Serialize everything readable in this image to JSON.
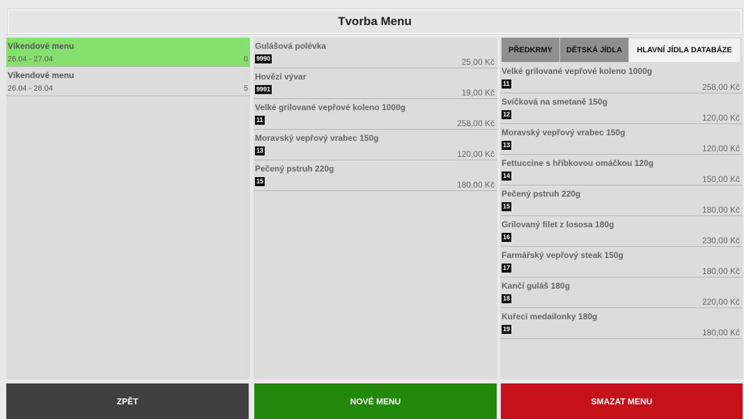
{
  "header": {
    "title": "Tvorba Menu"
  },
  "menus": [
    {
      "name": "Víkendové menu",
      "dates": "26.04 - 27.04",
      "count": "0",
      "selected": true
    },
    {
      "name": "Víkendové menu",
      "dates": "26.04 - 28.04",
      "count": "5",
      "selected": false
    }
  ],
  "menu_items": [
    {
      "name": "Gulášová polévka",
      "code": "9990",
      "price": "25,00 Kč"
    },
    {
      "name": "Hovězí vývar",
      "code": "9991",
      "price": "19,00 Kč"
    },
    {
      "name": "Velké grilované vepřové koleno 1000g",
      "code": "11",
      "price": "258,00 Kč"
    },
    {
      "name": "Moravský vepřový vrabec 150g",
      "code": "13",
      "price": "120,00 Kč"
    },
    {
      "name": "Pečený pstruh 220g",
      "code": "15",
      "price": "180,00 Kč"
    }
  ],
  "tabs": [
    {
      "label": "PŘEDKRMY",
      "active": false
    },
    {
      "label": "DĚTSKÁ JÍDLA",
      "active": false
    },
    {
      "label": "HLAVNÍ JÍDLA DATABÁZE",
      "active": true
    }
  ],
  "database_items": [
    {
      "name": "Velké grilované vepřové koleno 1000g",
      "code": "11",
      "price": "258,00 Kč"
    },
    {
      "name": "Svíčková na smetaně 150g",
      "code": "12",
      "price": "120,00 Kč"
    },
    {
      "name": "Moravský vepřový vrabec 150g",
      "code": "13",
      "price": "120,00 Kč"
    },
    {
      "name": "Fettuccine s hříbkovou omáčkou 120g",
      "code": "14",
      "price": "150,00 Kč"
    },
    {
      "name": "Pečený pstruh 220g",
      "code": "15",
      "price": "180,00 Kč"
    },
    {
      "name": "Grilovaný filet z lososa 180g",
      "code": "16",
      "price": "230,00 Kč"
    },
    {
      "name": "Farmářský vepřový steak 150g",
      "code": "17",
      "price": "180,00 Kč"
    },
    {
      "name": "Kančí guláš 180g",
      "code": "18",
      "price": "220,00 Kč"
    },
    {
      "name": "Kuřecí medailonky 180g",
      "code": "19",
      "price": "180,00 Kč"
    }
  ],
  "buttons": {
    "back": "ZPĚT",
    "new_menu": "NOVÉ MENU",
    "delete_menu": "SMAZAT MENU"
  },
  "colors": {
    "selected_row": "#86e06e",
    "back": "#404040",
    "new_menu": "#22880c",
    "delete_menu": "#c6111b"
  }
}
